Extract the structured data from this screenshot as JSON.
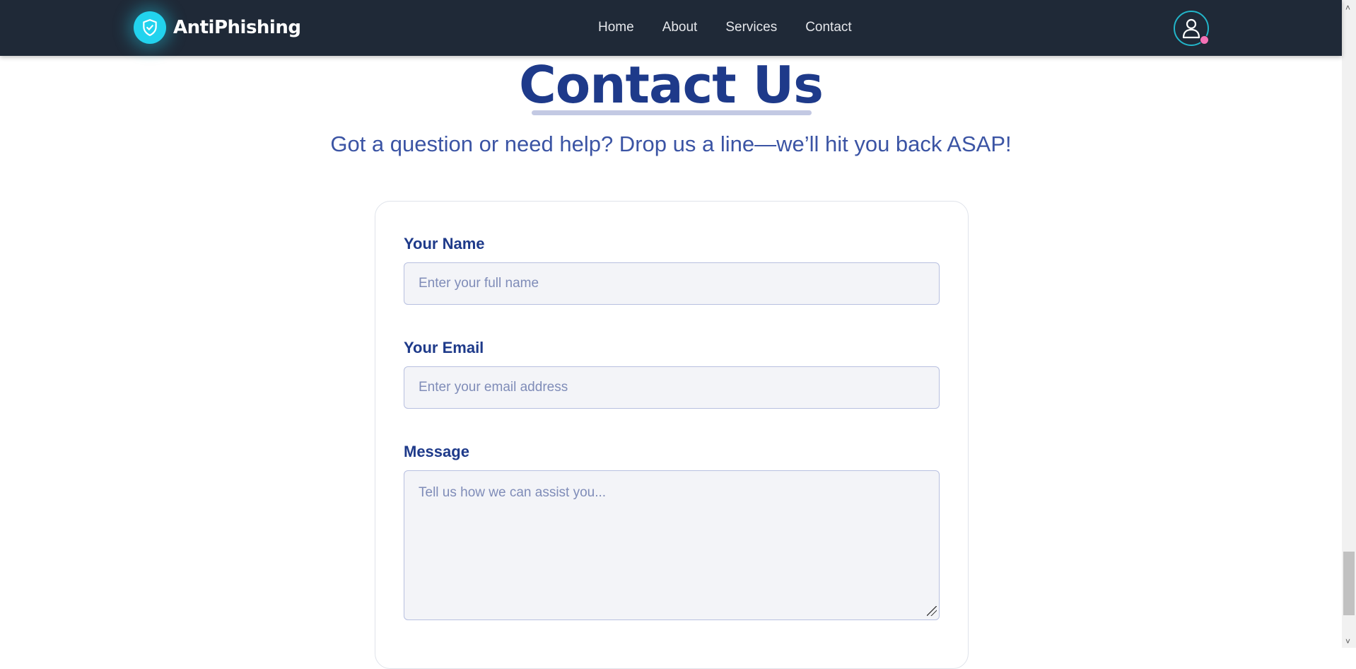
{
  "navbar": {
    "brand": "AntiPhishing",
    "brand_icon": "shield-check-icon",
    "links": [
      "Home",
      "About",
      "Services",
      "Contact"
    ],
    "avatar_icon": "user-icon"
  },
  "page": {
    "title": "Contact Us",
    "subtitle": "Got a question or need help? Drop us a line—we’ll hit you back ASAP!"
  },
  "form": {
    "name_label": "Your Name",
    "name_placeholder": "Enter your full name",
    "email_label": "Your Email",
    "email_placeholder": "Enter your email address",
    "message_label": "Message",
    "message_placeholder": "Tell us how we can assist you..."
  },
  "colors": {
    "navbar_bg": "#1f2937",
    "accent": "#22d3ee",
    "title": "#1e3a8a",
    "subtitle": "#3b54a4"
  }
}
